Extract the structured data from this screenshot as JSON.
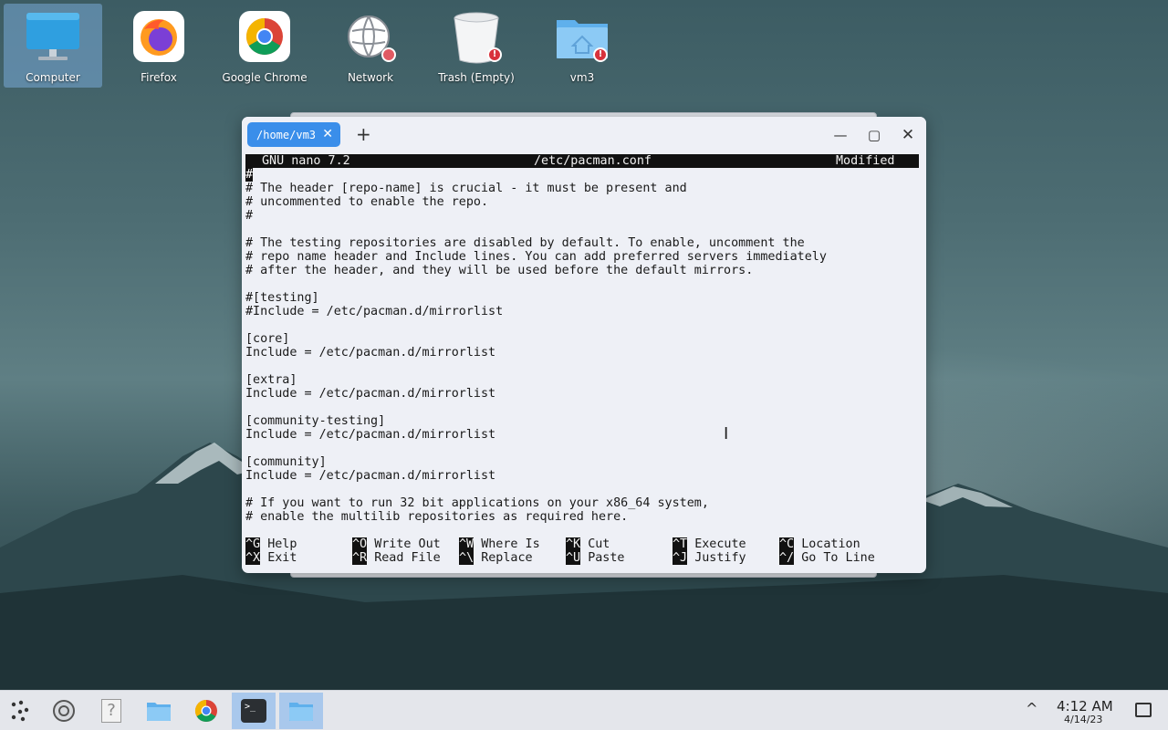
{
  "desktop": {
    "icons": [
      {
        "label": "Computer",
        "icon": "computer-icon"
      },
      {
        "label": "Firefox",
        "icon": "firefox-icon"
      },
      {
        "label": "Google Chrome",
        "icon": "chrome-icon"
      },
      {
        "label": "Network",
        "icon": "network-icon"
      },
      {
        "label": "Trash (Empty)",
        "icon": "trash-icon"
      },
      {
        "label": "vm3",
        "icon": "home-folder-icon"
      }
    ],
    "badge_glyph": "!"
  },
  "terminal": {
    "tab_label": "/home/vm3",
    "tab_close": "✕",
    "new_tab": "+",
    "minimize": "—",
    "maximize": "▢",
    "close": "✕",
    "nano": {
      "version": "GNU nano 7.2",
      "filename": "/etc/pacman.conf",
      "status": "Modified",
      "cursor_char": "#",
      "lines": [
        "",
        "# The header [repo-name] is crucial - it must be present and",
        "# uncommented to enable the repo.",
        "#",
        "",
        "# The testing repositories are disabled by default. To enable, uncomment the",
        "# repo name header and Include lines. You can add preferred servers immediately",
        "# after the header, and they will be used before the default mirrors.",
        "",
        "#[testing]",
        "#Include = /etc/pacman.d/mirrorlist",
        "",
        "[core]",
        "Include = /etc/pacman.d/mirrorlist",
        "",
        "[extra]",
        "Include = /etc/pacman.d/mirrorlist",
        "",
        "[community-testing]",
        "Include = /etc/pacman.d/mirrorlist",
        "",
        "[community]",
        "Include = /etc/pacman.d/mirrorlist",
        "",
        "# If you want to run 32 bit applications on your x86_64 system,",
        "# enable the multilib repositories as required here."
      ],
      "shortcuts": [
        {
          "key": "^G",
          "label": "Help"
        },
        {
          "key": "^O",
          "label": "Write Out"
        },
        {
          "key": "^W",
          "label": "Where Is"
        },
        {
          "key": "^K",
          "label": "Cut"
        },
        {
          "key": "^T",
          "label": "Execute"
        },
        {
          "key": "^C",
          "label": "Location"
        },
        {
          "key": "^X",
          "label": "Exit"
        },
        {
          "key": "^R",
          "label": "Read File"
        },
        {
          "key": "^\\",
          "label": "Replace"
        },
        {
          "key": "^U",
          "label": "Paste"
        },
        {
          "key": "^J",
          "label": "Justify"
        },
        {
          "key": "^/",
          "label": "Go To Line"
        }
      ]
    }
  },
  "taskbar": {
    "items": [
      {
        "icon": "app-launcher-icon",
        "active": false
      },
      {
        "icon": "system-settings-icon",
        "active": false
      },
      {
        "icon": "help-icon",
        "active": false
      },
      {
        "icon": "file-manager-icon",
        "active": false
      },
      {
        "icon": "chrome-icon",
        "active": false
      },
      {
        "icon": "terminal-icon",
        "active": true
      },
      {
        "icon": "file-manager-icon",
        "active": true
      }
    ],
    "help_glyph": "?",
    "terminal_glyph": ">_",
    "tray_expand": "^",
    "clock_time": "4:12 AM",
    "clock_date": "4/14/23"
  },
  "colors": {
    "accent": "#3a8eea",
    "taskbar_active": "#a9c8ec",
    "badge": "#d8323c"
  }
}
